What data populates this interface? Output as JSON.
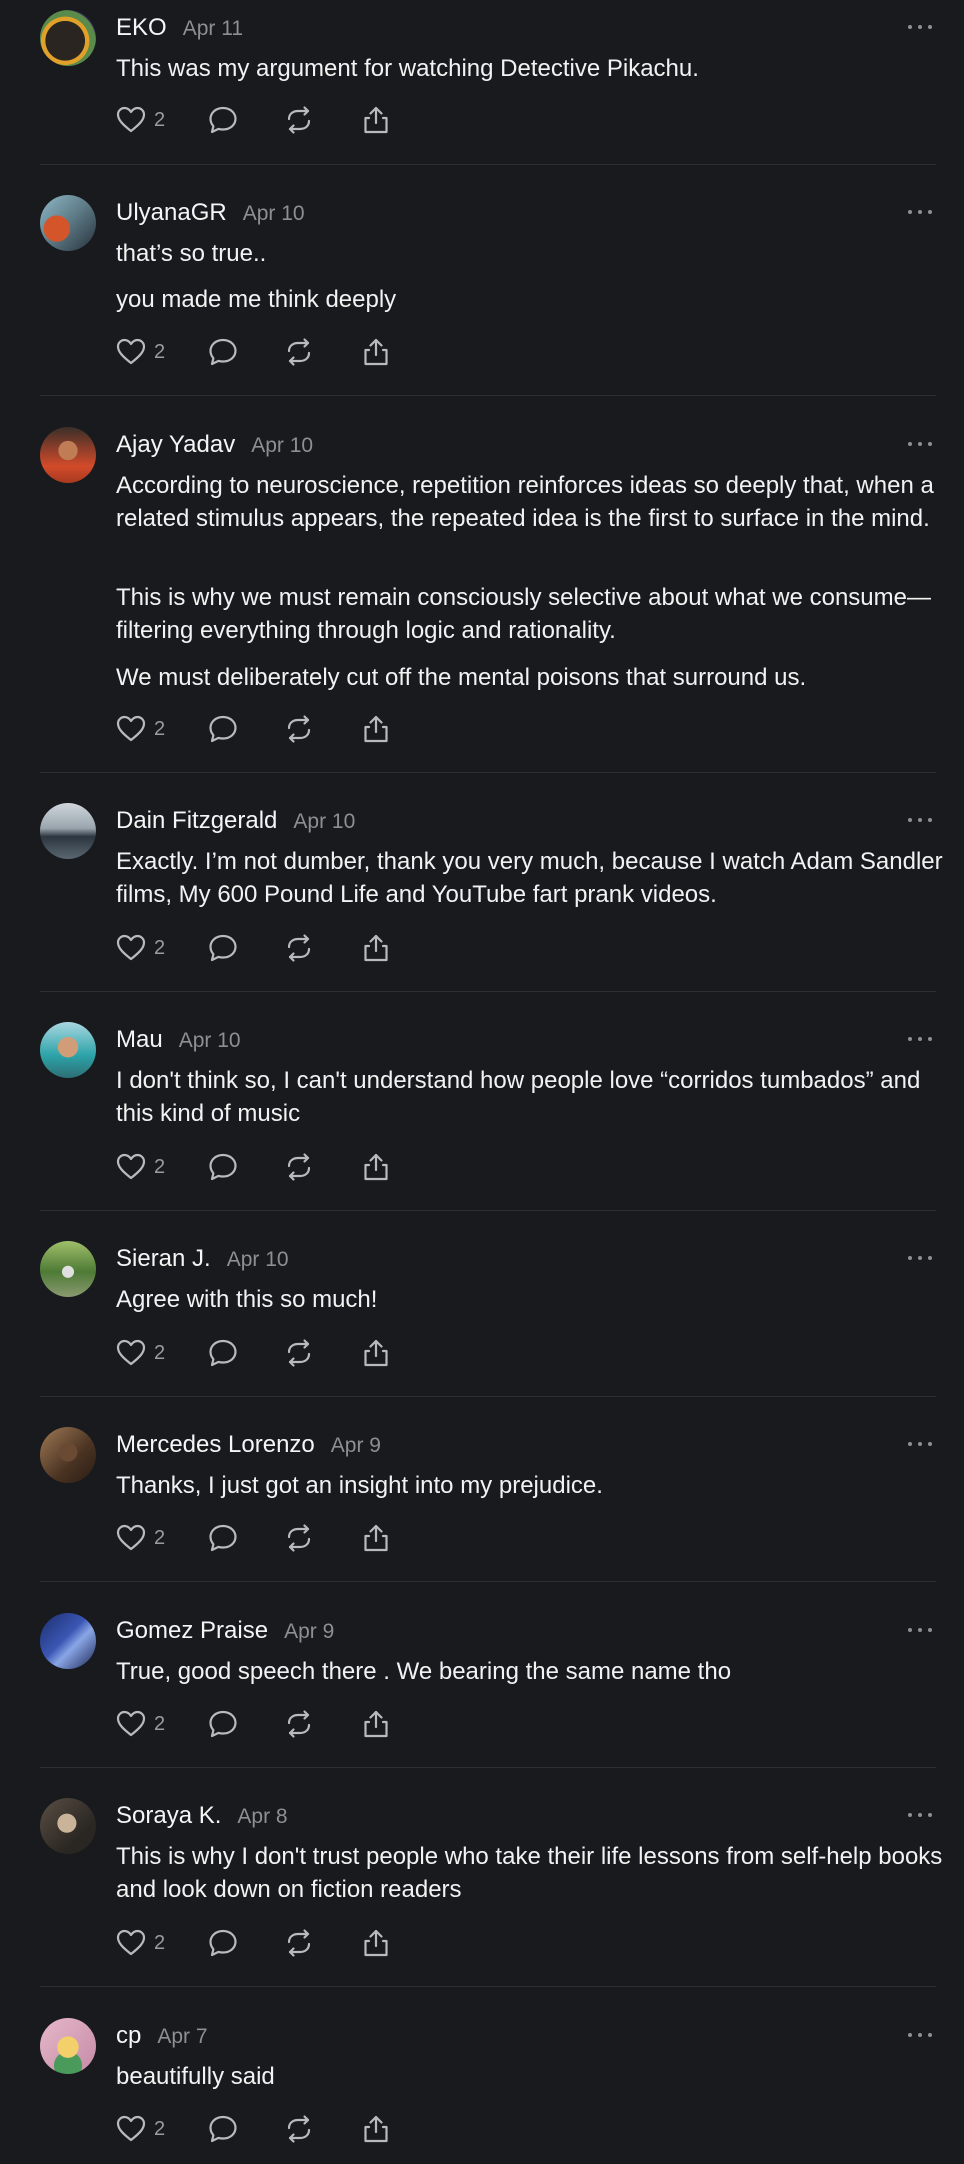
{
  "colors": {
    "background": "#181a1d",
    "divider": "#2c2e32",
    "muted_text": "#8d8f93",
    "icon": "#b8babd"
  },
  "icons": {
    "like": "heart-icon",
    "reply": "comment-icon",
    "repost": "repost-icon",
    "share": "share-icon",
    "more": "more-options-icon"
  },
  "posts": [
    {
      "name": "EKO",
      "date": "Apr 11",
      "paragraphs": [
        "This was my argument for watching Detective Pikachu."
      ],
      "likes": "2"
    },
    {
      "name": "UlyanaGR",
      "date": "Apr 10",
      "paragraphs": [
        "that’s so true..",
        "you made me think deeply"
      ],
      "likes": "2"
    },
    {
      "name": "Ajay Yadav",
      "date": "Apr 10",
      "paragraphs": [
        "According to neuroscience, repetition reinforces ideas so deeply that, when a related stimulus appears, the repeated idea is the first to surface in the mind.",
        "This is why we must remain consciously selective about what we consume—filtering everything through logic and rationality.",
        "We must deliberately cut off the mental poisons that surround us."
      ],
      "likes": "2"
    },
    {
      "name": "Dain Fitzgerald",
      "date": "Apr 10",
      "paragraphs": [
        "Exactly. I’m not dumber, thank you very much, because I watch Adam Sandler films, My 600 Pound Life and YouTube fart prank videos."
      ],
      "likes": "2"
    },
    {
      "name": "Mau",
      "date": "Apr 10",
      "paragraphs": [
        "I don't think so, I can't understand how people love “corridos tumbados” and this kind of music"
      ],
      "likes": "2"
    },
    {
      "name": "Sieran J.",
      "date": "Apr 10",
      "paragraphs": [
        "Agree with this so much!"
      ],
      "likes": "2"
    },
    {
      "name": "Mercedes Lorenzo",
      "date": "Apr 9",
      "paragraphs": [
        "Thanks, I just got an insight into my prejudice."
      ],
      "likes": "2"
    },
    {
      "name": "Gomez Praise",
      "date": "Apr 9",
      "paragraphs": [
        "True, good speech there . We bearing the same name tho"
      ],
      "likes": "2"
    },
    {
      "name": "Soraya K.",
      "date": "Apr 8",
      "paragraphs": [
        "This is why I don't trust people who take their life lessons from self-help books and look down on fiction readers"
      ],
      "likes": "2"
    },
    {
      "name": "cp",
      "date": "Apr 7",
      "paragraphs": [
        "beautifully said"
      ],
      "likes": "2"
    }
  ]
}
